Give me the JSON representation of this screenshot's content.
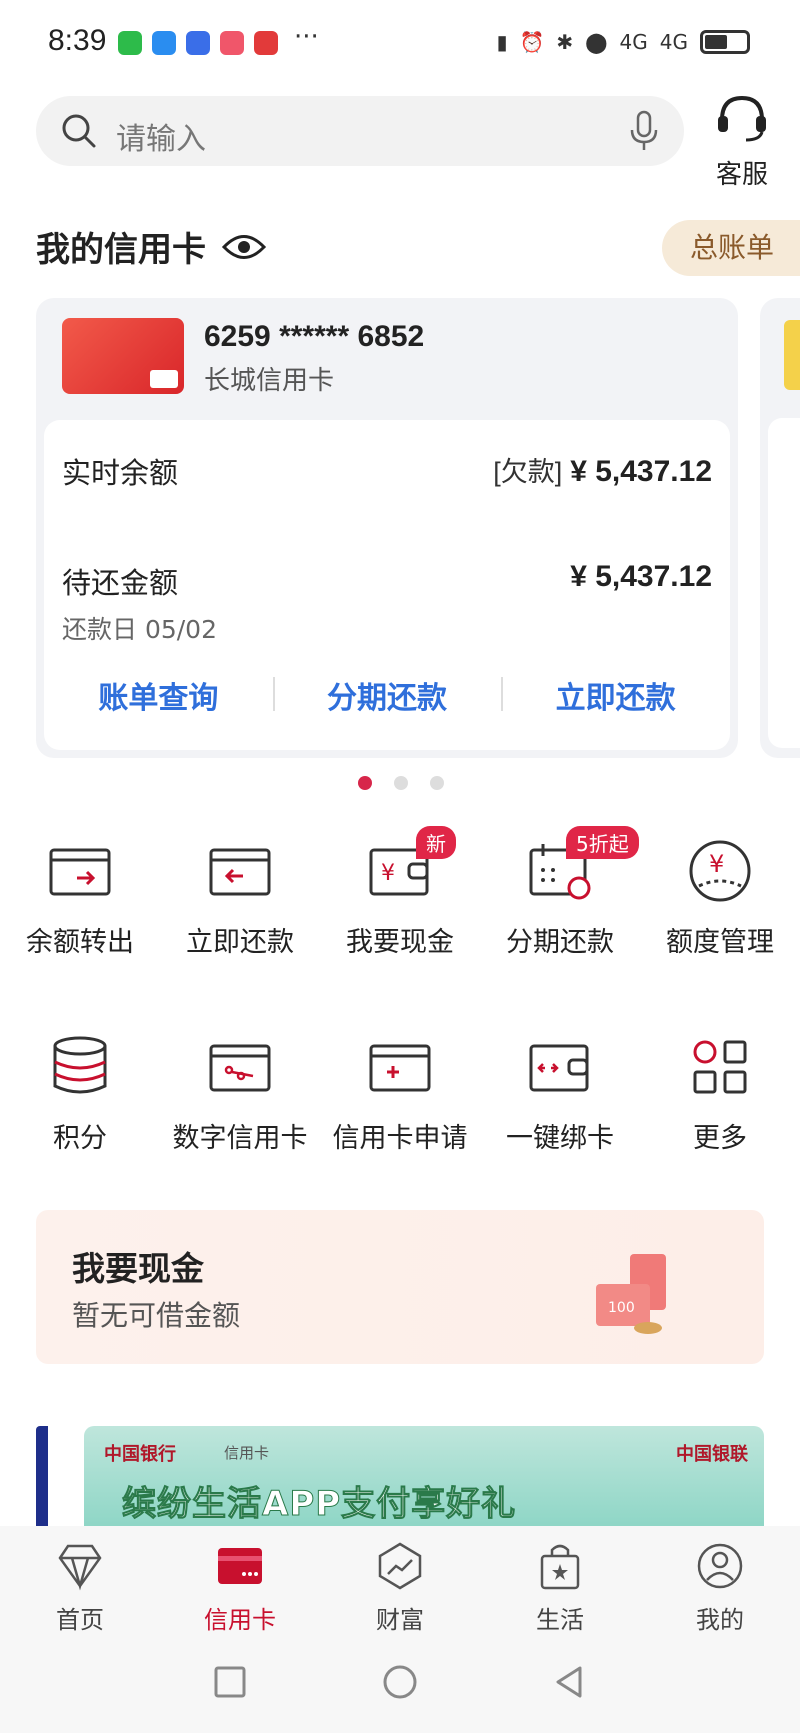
{
  "status": {
    "time": "8:39",
    "more": "···",
    "network": "4G"
  },
  "search": {
    "placeholder": "请输入"
  },
  "service": {
    "label": "客服"
  },
  "section": {
    "title": "我的信用卡",
    "bill_button": "总账单"
  },
  "card": {
    "number": "6259 ****** 6852",
    "name": "长城信用卡",
    "balance_label": "实时余额",
    "balance_tag": "[欠款]",
    "balance_value": "¥ 5,437.12",
    "due_label": "待还金额",
    "due_value": "¥ 5,437.12",
    "due_date": "还款日 05/02",
    "actions": [
      "账单查询",
      "分期还款",
      "立即还款"
    ]
  },
  "carousel": {
    "count": 3,
    "active": 0
  },
  "grid": {
    "row1": [
      {
        "label": "余额转出",
        "icon": "transfer-out-icon"
      },
      {
        "label": "立即还款",
        "icon": "repay-icon"
      },
      {
        "label": "我要现金",
        "icon": "cash-wallet-icon",
        "badge": "新"
      },
      {
        "label": "分期还款",
        "icon": "installment-icon",
        "badge": "5折起"
      },
      {
        "label": "额度管理",
        "icon": "limit-icon"
      }
    ],
    "row2": [
      {
        "label": "积分",
        "icon": "points-icon"
      },
      {
        "label": "数字信用卡",
        "icon": "digital-card-icon"
      },
      {
        "label": "信用卡申请",
        "icon": "apply-card-icon"
      },
      {
        "label": "一键绑卡",
        "icon": "bind-card-icon"
      },
      {
        "label": "更多",
        "icon": "more-grid-icon"
      }
    ]
  },
  "cash_banner": {
    "title": "我要现金",
    "subtitle": "暂无可借金额"
  },
  "promo": {
    "bank": "中国银行",
    "credit_card": "信用卡",
    "unionpay": "中国银联",
    "headline": "缤纷生活APP支付享好礼"
  },
  "tabs": [
    {
      "label": "首页",
      "icon": "diamond-icon"
    },
    {
      "label": "信用卡",
      "icon": "credit-card-icon",
      "active": true
    },
    {
      "label": "财富",
      "icon": "wealth-chart-icon"
    },
    {
      "label": "生活",
      "icon": "shopping-bag-icon"
    },
    {
      "label": "我的",
      "icon": "profile-icon"
    }
  ],
  "colors": {
    "accent": "#c8102e",
    "link": "#2f6fdb",
    "badge": "#e02647"
  }
}
